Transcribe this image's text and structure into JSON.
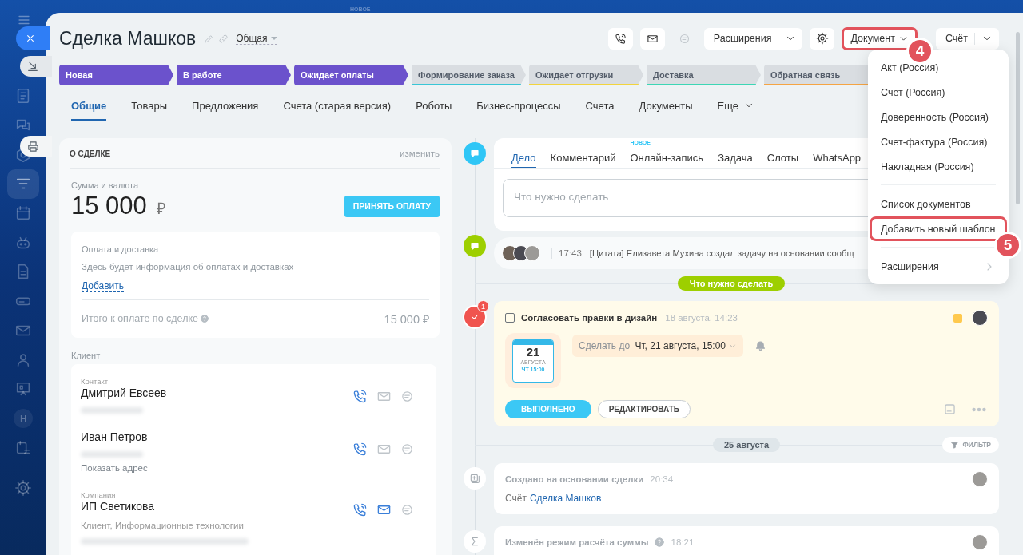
{
  "background_badge": "НОВОЕ",
  "sidebar": {
    "items": [
      {
        "selected": false
      },
      {
        "selected": false
      },
      {
        "selected": false
      },
      {
        "selected": true
      },
      {
        "selected": false
      },
      {
        "selected": false
      },
      {
        "selected": false
      },
      {
        "selected": false
      },
      {
        "selected": false
      },
      {
        "selected": false
      },
      {
        "selected": false
      },
      {
        "selected": false,
        "label": "H"
      },
      {
        "selected": false
      },
      {
        "selected": false
      }
    ]
  },
  "deal": {
    "title": "Сделка Машков",
    "category": "Общая"
  },
  "toolbar": {
    "buttons": [
      {
        "kind": "phone",
        "disabled": false,
        "highlighted": false
      },
      {
        "kind": "mail",
        "disabled": false,
        "highlighted": false
      },
      {
        "kind": "chat",
        "disabled": true,
        "highlighted": false
      },
      {
        "kind": "split",
        "label": "Расширения",
        "disabled": false,
        "highlighted": false
      },
      {
        "kind": "settings",
        "disabled": false,
        "highlighted": false
      },
      {
        "kind": "dropdown",
        "label": "Документ",
        "disabled": false,
        "highlighted": true,
        "step": "4"
      },
      {
        "kind": "split",
        "label": "Счёт",
        "disabled": false,
        "highlighted": false
      }
    ]
  },
  "stages": [
    {
      "label": "Новая",
      "passed": true,
      "color": "#6b52cc"
    },
    {
      "label": "В работе",
      "passed": true,
      "color": "#6b52cc"
    },
    {
      "label": "Ожидает оплаты",
      "passed": true,
      "color": "#6b52cc"
    },
    {
      "label": "Формирование заказа",
      "passed": false,
      "color": "#39c6d6"
    },
    {
      "label": "Ожидает отгрузки",
      "passed": false,
      "color": "#f2d43c"
    },
    {
      "label": "Доставка",
      "passed": false,
      "color": "#3dd6b5"
    },
    {
      "label": "Обратная связь",
      "passed": false,
      "color": "#f5a443"
    }
  ],
  "tabs": [
    {
      "label": "Общие",
      "selected": true,
      "kind": "tab"
    },
    {
      "label": "Товары",
      "selected": false,
      "kind": "tab"
    },
    {
      "label": "Предложения",
      "selected": false,
      "kind": "tab"
    },
    {
      "label": "Счета (старая версия)",
      "selected": false,
      "kind": "tab"
    },
    {
      "label": "Роботы",
      "selected": false,
      "kind": "tab"
    },
    {
      "label": "Бизнес-процессы",
      "selected": false,
      "kind": "tab"
    },
    {
      "label": "Счета",
      "selected": false,
      "kind": "tab"
    },
    {
      "label": "Документы",
      "selected": false,
      "kind": "tab"
    },
    {
      "label": "Еще",
      "selected": false,
      "kind": "more"
    }
  ],
  "about": {
    "heading": "О СДЕЛКЕ",
    "edit_link": "изменить",
    "amount_label": "Сумма и валюта",
    "amount": "15 000",
    "currency": "₽",
    "pay_button": "ПРИНЯТЬ ОПЛАТУ",
    "payment": {
      "title": "Оплата и доставка",
      "hint": "Здесь будет информация об оплатах и доставках",
      "add_link": "Добавить",
      "total_label": "Итого к оплате по сделке",
      "total": "15 000 ₽"
    },
    "client_label": "Клиент",
    "clients": [
      {
        "type_label": "Контакт",
        "name": "Дмитрий Евсеев",
        "mail_active": false,
        "blurred_line": true
      },
      {
        "name": "Иван Петров",
        "mail_active": false,
        "blurred_line": true,
        "address_link": "Показать адрес"
      },
      {
        "type_label": "Компания",
        "name": "ИП Светикова",
        "mail_active": true,
        "note": "Клиент, Информационные технологии",
        "blurred_line": true
      }
    ]
  },
  "editor": {
    "tabs": [
      {
        "label": "Дело",
        "selected": true
      },
      {
        "label": "Комментарий",
        "selected": false
      },
      {
        "label": "Онлайн-запись",
        "selected": false,
        "badge": "НОВОЕ"
      },
      {
        "label": "Задача",
        "selected": false
      },
      {
        "label": "Слоты",
        "selected": false
      },
      {
        "label": "WhatsApp",
        "selected": false
      }
    ],
    "placeholder": "Что нужно сделать"
  },
  "activity": {
    "time": "17:43",
    "text": "[Цитата] Елизавета Мухина создал задачу на основании сообщ"
  },
  "section_label": "Что нужно сделать",
  "task": {
    "badge": "1",
    "checked": false,
    "title": "Согласовать правки в дизайн",
    "created": "18 августа, 14:23",
    "calendar": {
      "day": "21",
      "month": "АВГУСТА",
      "time": "ЧТ 15:00"
    },
    "deadline_prefix": "Сделать до",
    "deadline": "Чт, 21 августа, 15:00",
    "done_button": "ВЫПОЛНЕНО",
    "edit_button": "РЕДАКТИРОВАТЬ"
  },
  "date_label": "25 августа",
  "filter_button": "ФИЛЬТР",
  "history": [
    {
      "kind": "created",
      "title": "Создано на основании сделки",
      "time": "20:34",
      "body_prefix": "Счёт",
      "link": "Сделка Машков",
      "help": false
    },
    {
      "kind": "sum",
      "title": "Изменён режим расчёта суммы",
      "time": "18:21",
      "help": true
    }
  ],
  "menu": {
    "items": [
      {
        "kind": "item",
        "label": "Акт (Россия)",
        "highlighted": false
      },
      {
        "kind": "item",
        "label": "Счет (Россия)",
        "highlighted": false
      },
      {
        "kind": "item",
        "label": "Доверенность (Россия)",
        "highlighted": false
      },
      {
        "kind": "item",
        "label": "Счет-фактура (Россия)",
        "highlighted": false
      },
      {
        "kind": "item",
        "label": "Накладная (Россия)",
        "highlighted": false
      },
      {
        "kind": "separator"
      },
      {
        "kind": "item",
        "label": "Список документов",
        "highlighted": false
      },
      {
        "kind": "item",
        "label": "Добавить новый шаблон",
        "highlighted": true,
        "step": "5"
      },
      {
        "kind": "separator"
      },
      {
        "kind": "submenu",
        "label": "Расширения",
        "highlighted": false
      }
    ]
  }
}
